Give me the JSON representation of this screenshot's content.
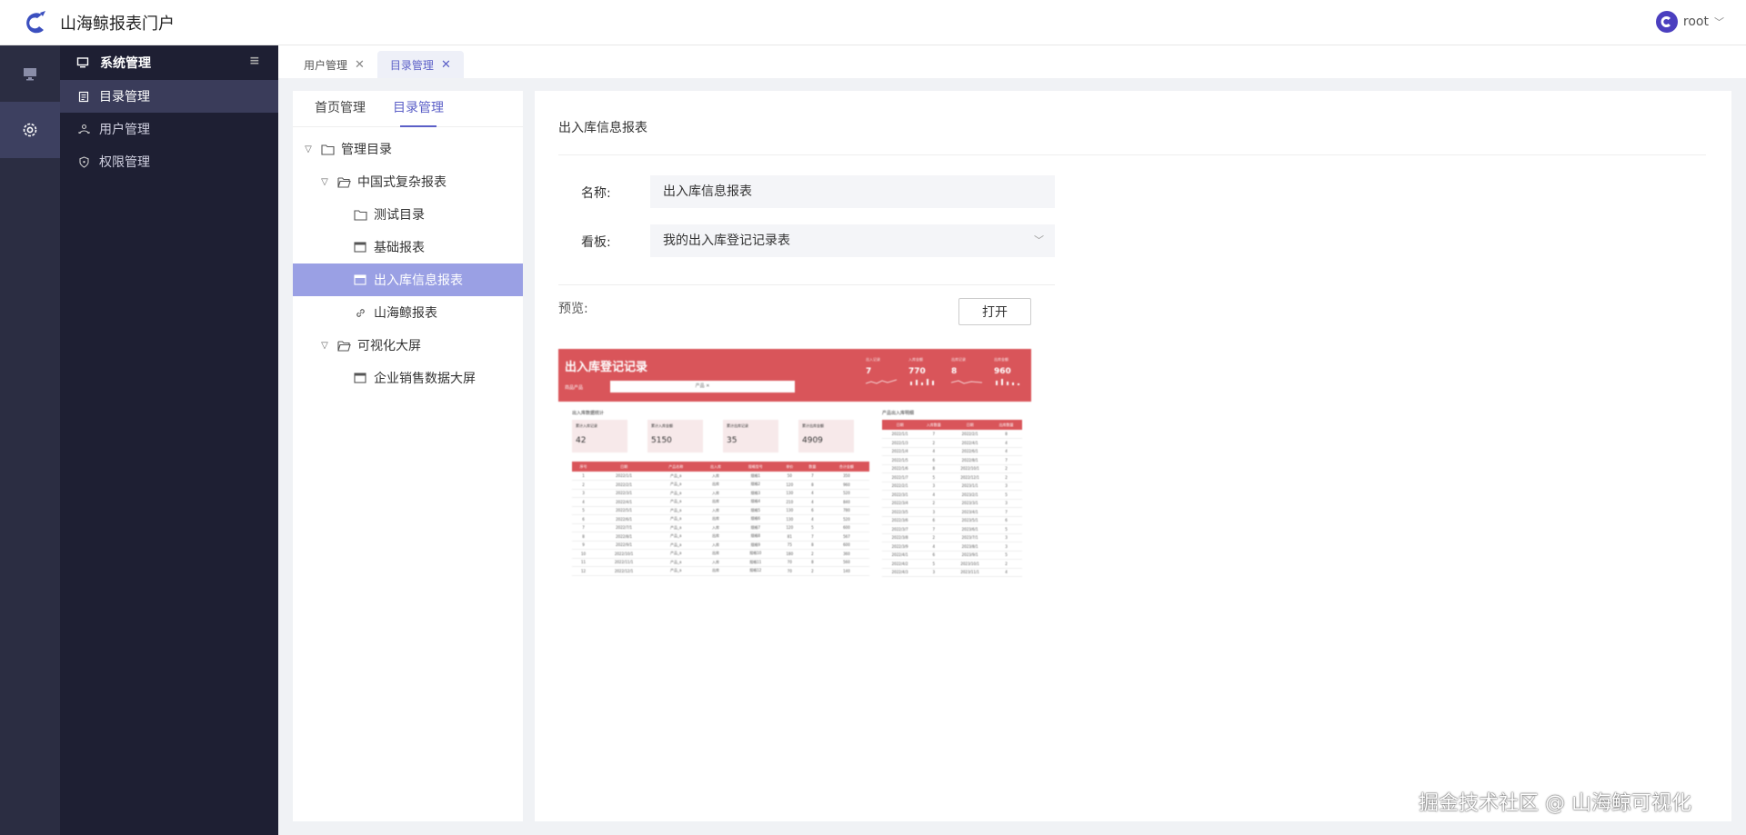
{
  "app": {
    "title": "山海鲸报表门户"
  },
  "user": {
    "name": "root"
  },
  "sidebar": {
    "group_label": "系统管理",
    "items": [
      {
        "label": "目录管理",
        "icon": "file-list-icon",
        "active": true
      },
      {
        "label": "用户管理",
        "icon": "users-icon",
        "active": false
      },
      {
        "label": "权限管理",
        "icon": "shield-icon",
        "active": false
      }
    ]
  },
  "tabs": [
    {
      "label": "用户管理",
      "active": false
    },
    {
      "label": "目录管理",
      "active": true
    }
  ],
  "tree_panel": {
    "tabs": [
      {
        "label": "首页管理",
        "active": false
      },
      {
        "label": "目录管理",
        "active": true
      }
    ],
    "nodes": [
      {
        "label": "管理目录",
        "level": 0,
        "type": "folder",
        "expanded": true
      },
      {
        "label": "中国式复杂报表",
        "level": 1,
        "type": "folder",
        "expanded": true
      },
      {
        "label": "测试目录",
        "level": 2,
        "type": "folder"
      },
      {
        "label": "基础报表",
        "level": 2,
        "type": "report"
      },
      {
        "label": "出入库信息报表",
        "level": 2,
        "type": "report",
        "selected": true
      },
      {
        "label": "山海鲸报表",
        "level": 2,
        "type": "link"
      },
      {
        "label": "可视化大屏",
        "level": 1,
        "type": "folder",
        "expanded": true
      },
      {
        "label": "企业销售数据大屏",
        "level": 2,
        "type": "report"
      }
    ]
  },
  "detail": {
    "title": "出入库信息报表",
    "name_label": "名称:",
    "name_value": "出入库信息报表",
    "board_label": "看板:",
    "board_value": "我的出入库登记记录表",
    "preview_label": "预览:",
    "open_button": "打开"
  },
  "preview": {
    "title": "出入库登记记录",
    "filter_label": "商品产品",
    "filter_value": "产品 ✕",
    "stats": [
      {
        "label": "出入记录",
        "value": "7"
      },
      {
        "label": "入库金额",
        "value": "770"
      },
      {
        "label": "出库记录",
        "value": "8"
      },
      {
        "label": "出库金额",
        "value": "960"
      }
    ],
    "section_left": "出入库数据统计",
    "section_right": "产品出入库明细",
    "cards": [
      {
        "label": "累计入库记录",
        "value": "42"
      },
      {
        "label": "累计入库金额",
        "value": "5150"
      },
      {
        "label": "累计出库记录",
        "value": "35"
      },
      {
        "label": "累计出库金额",
        "value": "4909"
      }
    ],
    "left_cols": [
      "序号",
      "日期",
      "产品名称",
      "出入库",
      "规格型号",
      "单价",
      "数量",
      "合计金额"
    ],
    "left_rows": [
      [
        "1",
        "2022/1/1",
        "产品_a",
        "入库",
        "规格1",
        "50",
        "7",
        "350"
      ],
      [
        "2",
        "2022/2/1",
        "产品_a",
        "出库",
        "规格2",
        "120",
        "8",
        "960"
      ],
      [
        "3",
        "2022/3/1",
        "产品_a",
        "入库",
        "规格3",
        "130",
        "4",
        "520"
      ],
      [
        "4",
        "2022/4/1",
        "产品_a",
        "出库",
        "规格4",
        "210",
        "4",
        "840"
      ],
      [
        "5",
        "2022/5/1",
        "产品_a",
        "入库",
        "规格5",
        "130",
        "6",
        "780"
      ],
      [
        "6",
        "2022/6/1",
        "产品_a",
        "出库",
        "规格6",
        "130",
        "4",
        "520"
      ],
      [
        "7",
        "2022/7/1",
        "产品_a",
        "入库",
        "规格7",
        "120",
        "5",
        "600"
      ],
      [
        "8",
        "2022/8/1",
        "产品_a",
        "出库",
        "规格8",
        "81",
        "7",
        "567"
      ],
      [
        "9",
        "2022/9/1",
        "产品_a",
        "入库",
        "规格9",
        "75",
        "8",
        "600"
      ],
      [
        "10",
        "2022/10/1",
        "产品_a",
        "出库",
        "规格10",
        "180",
        "2",
        "360"
      ],
      [
        "11",
        "2022/11/1",
        "产品_a",
        "入库",
        "规格11",
        "70",
        "8",
        "560"
      ],
      [
        "12",
        "2022/12/1",
        "产品_a",
        "出库",
        "规格12",
        "70",
        "2",
        "140"
      ]
    ],
    "right_cols": [
      "日期",
      "入库数量",
      "日期",
      "出库数量"
    ],
    "right_rows": [
      [
        "2022/1/1",
        "7",
        "2022/2/1",
        "8"
      ],
      [
        "2022/1/3",
        "2",
        "2022/4/1",
        "4"
      ],
      [
        "2022/1/4",
        "4",
        "2022/6/1",
        "4"
      ],
      [
        "2022/1/5",
        "6",
        "2022/8/1",
        "7"
      ],
      [
        "2022/1/6",
        "8",
        "2022/10/1",
        "2"
      ],
      [
        "2022/1/7",
        "5",
        "2022/12/1",
        "2"
      ],
      [
        "2022/2/1",
        "3",
        "2023/1/1",
        "3"
      ],
      [
        "2022/3/1",
        "4",
        "2023/2/1",
        "5"
      ],
      [
        "2022/3/4",
        "2",
        "2023/3/1",
        "3"
      ],
      [
        "2022/3/5",
        "3",
        "2023/4/1",
        "7"
      ],
      [
        "2022/3/6",
        "6",
        "2023/5/1",
        "6"
      ],
      [
        "2022/3/7",
        "7",
        "2023/6/1",
        "5"
      ],
      [
        "2022/3/8",
        "2",
        "2023/7/1",
        "3"
      ],
      [
        "2022/3/9",
        "4",
        "2023/8/1",
        "3"
      ],
      [
        "2022/4/1",
        "6",
        "2023/9/1",
        "5"
      ],
      [
        "2022/4/2",
        "5",
        "2023/10/1",
        "2"
      ],
      [
        "2022/4/3",
        "3",
        "2023/11/1",
        "4"
      ]
    ]
  },
  "watermark": "掘金技术社区 @ 山海鲸可视化",
  "colors": {
    "accent": "#5b5fc7",
    "selected_row": "#9aa0e4",
    "preview_red": "#d9555a",
    "sidebar_bg": "#1e1f33",
    "rail_bg": "#2b2d42"
  }
}
